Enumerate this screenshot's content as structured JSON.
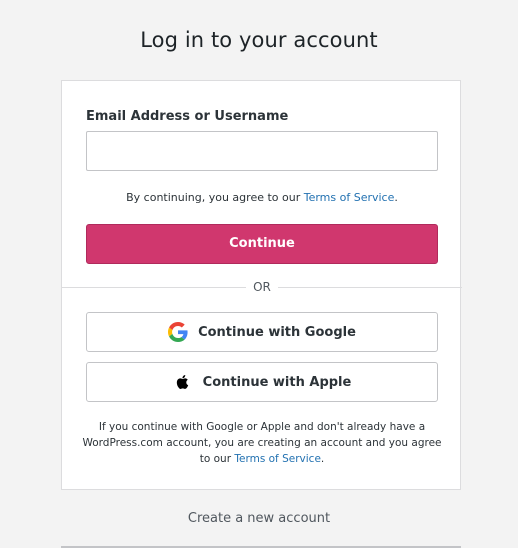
{
  "header": {
    "title": "Log in to your account"
  },
  "form": {
    "field_label": "Email Address or Username",
    "field_value": "",
    "tos_prefix": "By continuing, you agree to our ",
    "tos_link": "Terms of Service",
    "tos_suffix": ".",
    "continue_label": "Continue",
    "or_label": "OR"
  },
  "social": {
    "google_label": "Continue with Google",
    "google_icon": "google-icon",
    "apple_label": "Continue with Apple",
    "apple_icon": "apple-icon"
  },
  "disclaimer": {
    "text": "If you continue with Google or Apple and don't already have a WordPress.com account, you are creating an account and you agree to our ",
    "link": "Terms of Service",
    "suffix": "."
  },
  "footer": {
    "create_account": "Create a new account"
  },
  "colors": {
    "accent": "#d0376e",
    "link": "#2271b1",
    "background": "#f3f3f3"
  }
}
